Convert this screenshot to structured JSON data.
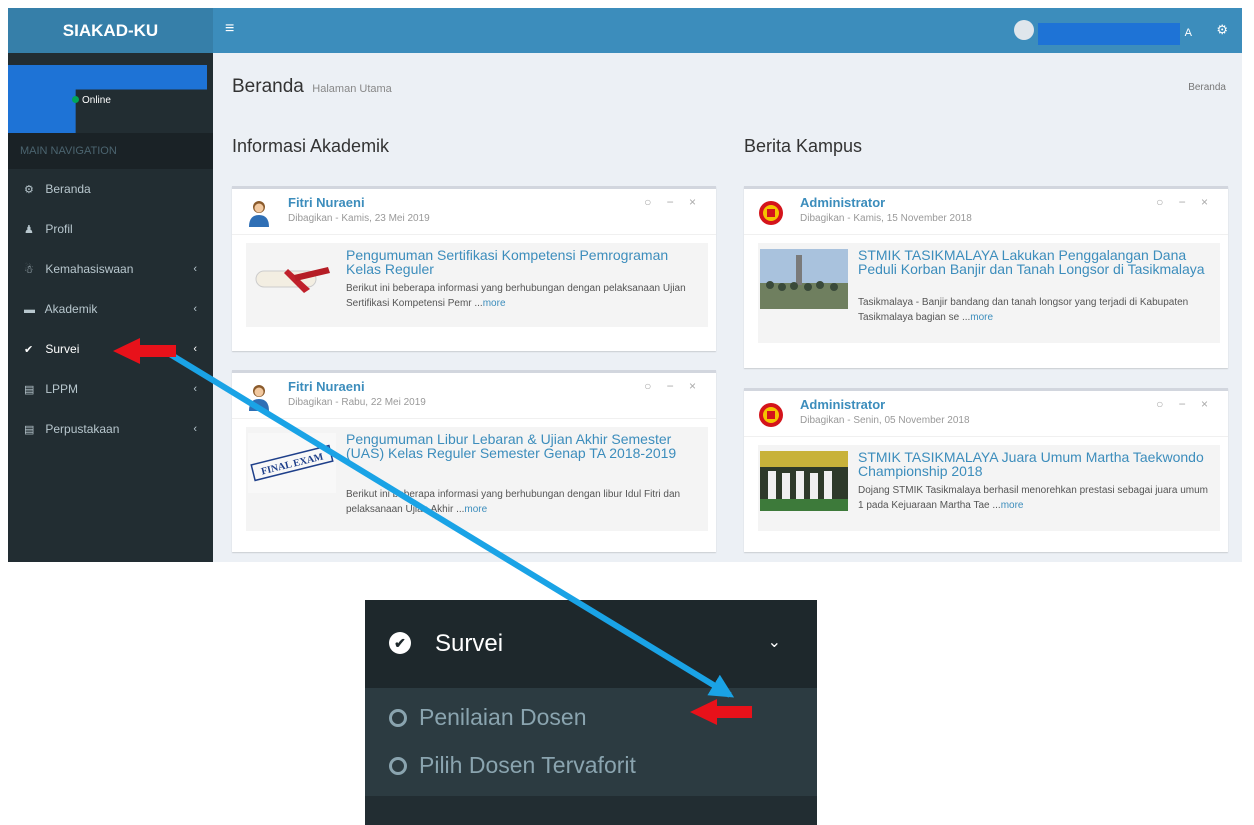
{
  "app": {
    "logo": "SIAKAD-KU",
    "hamburger_icon": "≡",
    "user_name_tail": "A",
    "gears_icon": "⚙"
  },
  "sidebar": {
    "status": "Online",
    "nav_header": "MAIN NAVIGATION",
    "items": [
      {
        "label": "Beranda",
        "icon": "⚙",
        "chevron": ""
      },
      {
        "label": "Profil",
        "icon": "♟",
        "chevron": ""
      },
      {
        "label": "Kemahasiswaan",
        "icon": "☃",
        "chevron": "‹"
      },
      {
        "label": "Akademik",
        "icon": "▬",
        "chevron": "‹"
      },
      {
        "label": "Survei",
        "icon": "✔",
        "chevron": "‹"
      },
      {
        "label": "LPPM",
        "icon": "▤",
        "chevron": "‹"
      },
      {
        "label": "Perpustakaan",
        "icon": "▤",
        "chevron": "‹"
      }
    ]
  },
  "header": {
    "title": "Beranda",
    "subtitle": "Halaman Utama",
    "breadcrumb": "Beranda"
  },
  "sections": {
    "left_title": "Informasi Akademik",
    "right_title": "Berita Kampus"
  },
  "posts": [
    {
      "author": "Fitri Nuraeni",
      "date": "Dibagikan - Kamis, 23 Mei 2019",
      "title": "Pengumuman Sertifikasi Kompetensi Pemrograman Kelas Reguler",
      "desc": "Berikut ini beberapa informasi yang berhubungan dengan pelaksanaan Ujian Sertifikasi Kompetensi Pemr ...",
      "more": "more"
    },
    {
      "author": "Fitri Nuraeni",
      "date": "Dibagikan - Rabu, 22 Mei 2019",
      "title": "Pengumuman Libur Lebaran & Ujian Akhir Semester (UAS) Kelas Reguler Semester Genap TA 2018-2019",
      "desc": "Berikut ini beberapa informasi yang berhubungan dengan libur Idul Fitri dan pelaksanaan Ujian Akhir ...",
      "more": "more"
    },
    {
      "author": "Administrator",
      "date": "Dibagikan - Kamis, 15 November 2018",
      "title": "STMIK TASIKMALAYA Lakukan Penggalangan Dana Peduli Korban Banjir dan Tanah Longsor di Tasikmalaya",
      "desc": "Tasikmalaya - Banjir bandang dan tanah longsor yang terjadi di Kabupaten Tasikmalaya bagian se ...",
      "more": "more"
    },
    {
      "author": "Administrator",
      "date": "Dibagikan - Senin, 05 November 2018",
      "title": "STMIK TASIKMALAYA Juara Umum Martha Taekwondo Championship 2018",
      "desc": "Dojang STMIK Tasikmalaya berhasil menorehkan prestasi sebagai juara umum 1 pada Kejuaraan Martha Tae ...",
      "more": "more"
    }
  ],
  "box_tools": "○ − ×",
  "inset": {
    "title": "Survei",
    "chevron": "⌄",
    "items": [
      "Penilaian Dosen",
      "Pilih Dosen Tervaforit"
    ]
  },
  "colors": {
    "header": "#3c8dbc",
    "sidebar": "#222d32",
    "arrow_red": "#e8111a",
    "arrow_blue": "#1aa3e6",
    "redaction": "#1e73d6"
  },
  "icons": [
    "hamburger-icon",
    "gears-icon",
    "check-circle-icon",
    "chevron-down-icon",
    "circle-icon"
  ]
}
